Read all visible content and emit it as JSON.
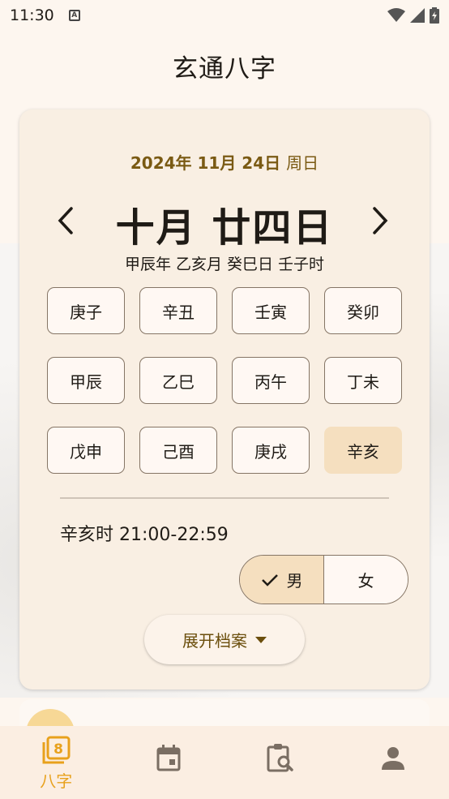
{
  "status_bar": {
    "time": "11:30",
    "notif_letter": "A"
  },
  "app_bar": {
    "title": "玄通八字"
  },
  "date_card": {
    "solar_date": "2024年 11月 24日",
    "weekday": "周日",
    "lunar_date": "十月 廿四日",
    "ganzhi": "甲辰年 乙亥月 癸巳日 壬子时",
    "hours": [
      "庚子",
      "辛丑",
      "壬寅",
      "癸卯",
      "甲辰",
      "乙巳",
      "丙午",
      "丁未",
      "戊申",
      "己酉",
      "庚戌",
      "辛亥"
    ],
    "selected_hour": "辛亥",
    "hour_range": "辛亥时 21:00-22:59",
    "gender": {
      "male": "男",
      "female": "女",
      "selected": "男"
    },
    "expand_label": "展开档案"
  },
  "bottom_nav": {
    "items": [
      {
        "label": "八字",
        "icon": "bazi-book-icon",
        "active": true
      },
      {
        "label": "",
        "icon": "calendar-icon",
        "active": false
      },
      {
        "label": "",
        "icon": "clipboard-search-icon",
        "active": false
      },
      {
        "label": "",
        "icon": "person-icon",
        "active": false
      }
    ]
  },
  "colors": {
    "accent": "#e8a11c",
    "chip_selected": "#f5dfbf",
    "card_bg": "#f9efe3",
    "date_text": "#7a5a13"
  }
}
